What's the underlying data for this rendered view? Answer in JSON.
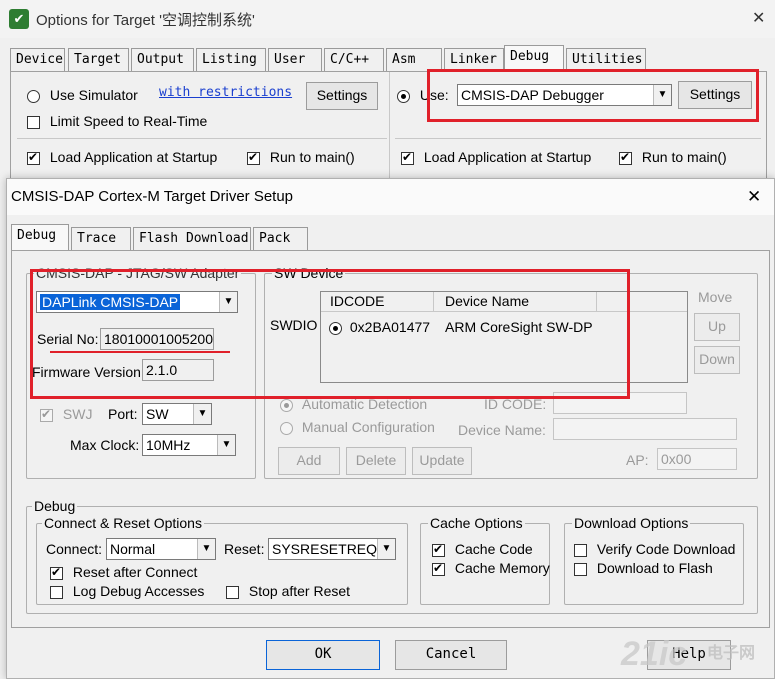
{
  "outer": {
    "title": "Options for Target '空调控制系统'",
    "app_icon": "uvision-icon",
    "tabs": [
      "Device",
      "Target",
      "Output",
      "Listing",
      "User",
      "C/C++",
      "Asm",
      "Linker",
      "Debug",
      "Utilities"
    ],
    "left": {
      "use_simulator": "Use Simulator",
      "restrictions_link": "with restrictions",
      "settings": "Settings",
      "limit_speed": "Limit Speed to Real-Time",
      "load_app": "Load Application at Startup",
      "run_to_main": "Run to main()"
    },
    "right": {
      "use_label": "Use:",
      "debugger": "CMSIS-DAP Debugger",
      "settings": "Settings",
      "load_app": "Load Application at Startup",
      "run_to_main": "Run to main()"
    }
  },
  "inner": {
    "title": "CMSIS-DAP Cortex-M Target Driver Setup",
    "tabs": [
      "Debug",
      "Trace",
      "Flash Download",
      "Pack"
    ],
    "adapter": {
      "group_label": "CMSIS-DAP - JTAG/SW Adapter",
      "device": "DAPLink CMSIS-DAP",
      "serial_label": "Serial No:",
      "serial_value": "18010001005200€",
      "firmware_label": "Firmware Version:",
      "firmware_value": "2.1.0",
      "swj_label": "SWJ",
      "port_label": "Port:",
      "port_value": "SW",
      "clock_label": "Max Clock:",
      "clock_value": "10MHz"
    },
    "sw_device": {
      "group_label": "SW Device",
      "swdio_label": "SWDIO",
      "col_idcode": "IDCODE",
      "col_device_name": "Device Name",
      "row_idcode": "0x2BA01477",
      "row_device_name": "ARM CoreSight SW-DP",
      "move_label": "Move",
      "up": "Up",
      "down": "Down",
      "automatic_detection": "Automatic Detection",
      "manual_configuration": "Manual Configuration",
      "id_code_label": "ID CODE:",
      "device_name_label": "Device Name:",
      "ap_label": "AP:",
      "ap_value": "0x00",
      "add": "Add",
      "delete": "Delete",
      "update": "Update"
    },
    "debug": {
      "group_label": "Debug",
      "connect_reset_label": "Connect & Reset Options",
      "connect_label": "Connect:",
      "connect_value": "Normal",
      "reset_label": "Reset:",
      "reset_value": "SYSRESETREQ",
      "reset_after_connect": "Reset after Connect",
      "log_debug_accesses": "Log Debug Accesses",
      "stop_after_reset": "Stop after Reset",
      "cache_label": "Cache Options",
      "cache_code": "Cache Code",
      "cache_memory": "Cache Memory",
      "download_label": "Download Options",
      "verify_code_download": "Verify Code Download",
      "download_to_flash": "Download to Flash"
    },
    "buttons": {
      "ok": "OK",
      "cancel": "Cancel",
      "help": "Help"
    },
    "watermark": {
      "logo": "21ic",
      "site": "电子网"
    }
  },
  "colors": {
    "highlight": "#e0202a",
    "selection": "#0a64d8"
  }
}
